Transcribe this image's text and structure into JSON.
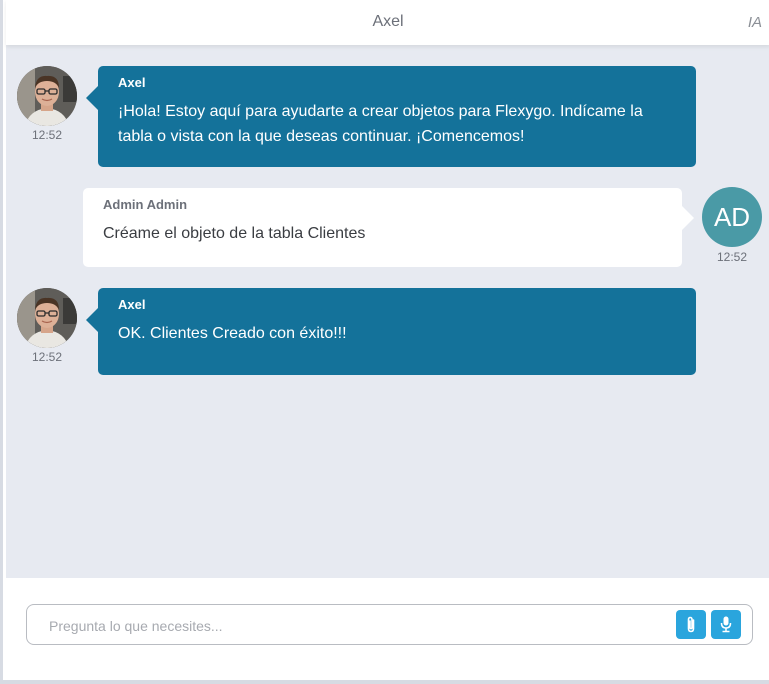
{
  "header": {
    "title": "Axel",
    "badge": "IA"
  },
  "messages": [
    {
      "role": "bot",
      "sender": "Axel",
      "text_lines": [
        "¡Hola! Estoy aquí para ayudarte a crear objetos para Flexygo. Indícame la",
        "tabla o vista con la que deseas continuar. ¡Comencemos!"
      ],
      "time": "12:52",
      "avatar_icon": "user-photo-avatar"
    },
    {
      "role": "user",
      "sender": "Admin Admin",
      "text_lines": [
        "Créame el objeto de la tabla Clientes"
      ],
      "time": "12:52",
      "avatar_initials": "AD"
    },
    {
      "role": "bot",
      "sender": "Axel",
      "text_lines": [
        "OK. Clientes Creado con éxito!!!"
      ],
      "time": "12:52",
      "avatar_icon": "user-photo-avatar"
    }
  ],
  "composer": {
    "placeholder": "Pregunta lo que necesites...",
    "value": "",
    "attach_icon": "paperclip-icon",
    "mic_icon": "microphone-icon"
  },
  "colors": {
    "bot_bubble": "#14729a",
    "user_bubble": "#ffffff",
    "chat_background": "#e7eaf1",
    "initials_avatar": "#4a9aa6",
    "icon_button": "#2aa5dd"
  }
}
